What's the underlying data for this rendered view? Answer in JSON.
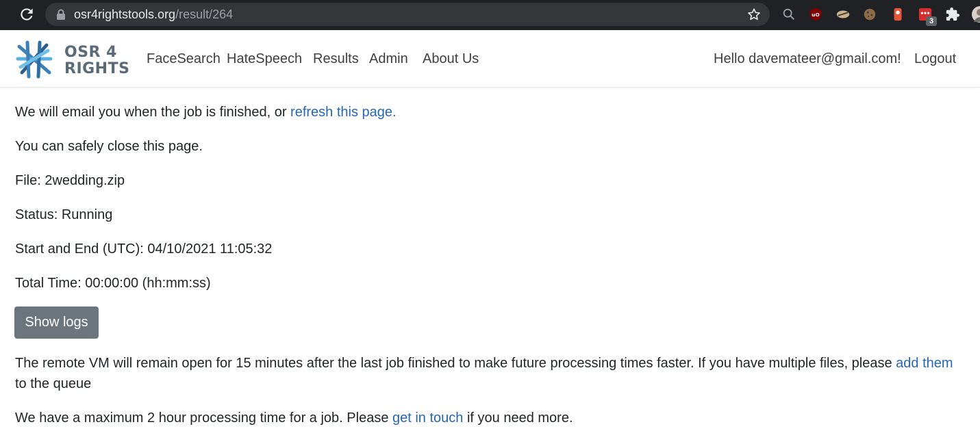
{
  "browser": {
    "url_host": "osr4rightstools.org",
    "url_path": "/result/264",
    "extension_badge": "3",
    "icons": [
      "reload-icon",
      "lock-icon",
      "star-icon",
      "search-icon",
      "ublock-icon",
      "extension-icon",
      "puzzle-icon",
      "profile-avatar"
    ]
  },
  "site": {
    "logo": {
      "line1": "OSR 4",
      "line2": "RIGHTS"
    },
    "nav": [
      {
        "label": "FaceSearch"
      },
      {
        "label": "HateSpeech"
      },
      {
        "label": "Results"
      },
      {
        "label": "Admin"
      },
      {
        "label": "About Us"
      }
    ],
    "greeting": "Hello davemateer@gmail.com!",
    "logout": "Logout"
  },
  "main": {
    "email_notice_prefix": "We will email you when the job is finished, or ",
    "refresh_link": "refresh this page.",
    "close_notice": "You can safely close this page.",
    "file": "File: 2wedding.zip",
    "status": "Status: Running",
    "start_end": "Start and End (UTC): 04/10/2021 11:05:32",
    "total_time": "Total Time: 00:00:00 (hh:mm:ss)",
    "show_logs_button": "Show logs",
    "vm_notice_prefix": "The remote VM will remain open for 15 minutes after the last job finished to make future processing times faster. If you have multiple files, please ",
    "add_them_link": "add them",
    "vm_notice_suffix": "to the queue",
    "max_time_prefix": "We have a maximum 2 hour processing time for a job. Please ",
    "get_in_touch_link": "get in touch",
    "max_time_suffix": " if you need more."
  },
  "colors": {
    "link": "#2666b5",
    "button_bg": "#6c757d",
    "chrome_bg": "#202124"
  }
}
